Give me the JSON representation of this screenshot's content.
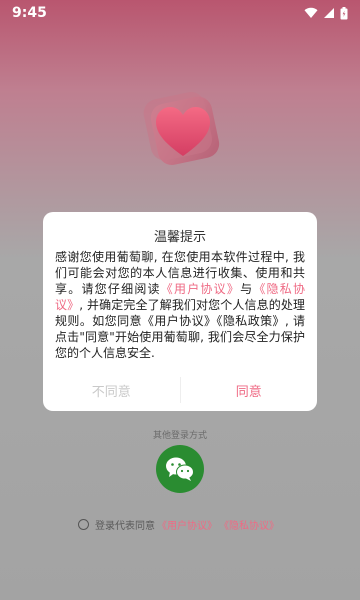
{
  "status_bar": {
    "time": "9:45",
    "icons": [
      "wifi-icon",
      "signal-icon",
      "battery-icon"
    ]
  },
  "dialog": {
    "title": "温馨提示",
    "body_parts": {
      "p1": "感谢您使用葡萄聊, 在您使用本软件过程中, 我们可能会对您的本人信息进行收集、使用和共享。请您仔细阅读",
      "link_user": "《用户协议》",
      "p2": "与",
      "link_privacy": "《隐私协议》",
      "p3": ", 并确定完全了解我们对您个人信息的处理规则。如您同意《用户协议》《隐私政策》, 请点击\"同意\"开始使用葡萄聊, 我们会尽全力保护您的个人信息安全."
    },
    "disagree_label": "不同意",
    "agree_label": "同意"
  },
  "login": {
    "other_methods_label": "其他登录方式",
    "wechat_icon": "wechat-icon"
  },
  "agreement": {
    "prefix": "登录代表同意",
    "user_agreement": "《用户协议》",
    "privacy_agreement": "《隐私协议》"
  },
  "colors": {
    "accent": "#ef6a84",
    "wechat_green": "#2a8c31"
  }
}
